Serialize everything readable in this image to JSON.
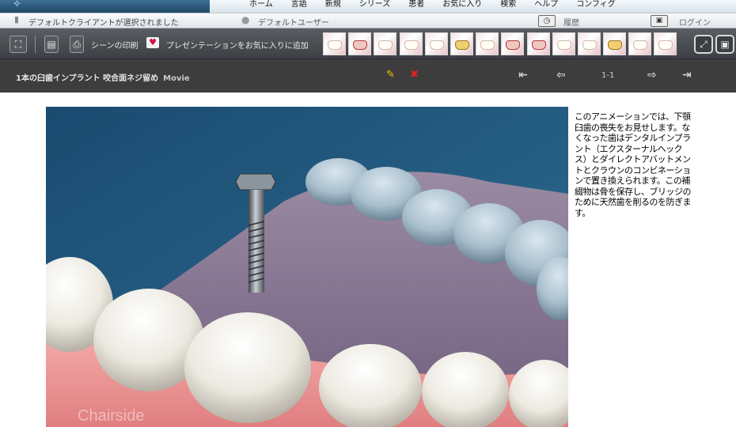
{
  "topnav": {
    "menu": [
      "ホーム",
      "言語",
      "新規",
      "シリーズ",
      "患者",
      "お気に入り",
      "検索",
      "ヘルプ",
      "コンフィグ"
    ]
  },
  "status": {
    "client": "デフォルトクライアントが選択されました",
    "user": "デフォルトユーザー",
    "history": "履歴",
    "login": "ログイン"
  },
  "toolbar": {
    "print_label": "シーンの印刷",
    "favorite_label": "プレゼンテーションをお気に入りに追加"
  },
  "scene": {
    "title": "1本の臼歯インプラント 咬合面ネジ留め",
    "type": "Movie",
    "pager": "1-1"
  },
  "content": {
    "description": "このアニメーションでは、下顎臼歯の喪失をお見せします。なくなった歯はデンタルインプラント（エクスターナルヘックス）とダイレクトアバットメントとクラウンのコンビネーションで置き換えられます。この補綴物は骨を保存し、ブリッジのために天然歯を削るのを防ぎます。",
    "watermark": "Chairside"
  },
  "colors": {
    "toolbar_bg": "#4a4e52",
    "titlebar_bg": "#3d3d3d",
    "video_bg": "#1f4f73",
    "heart": "#d0114a"
  }
}
